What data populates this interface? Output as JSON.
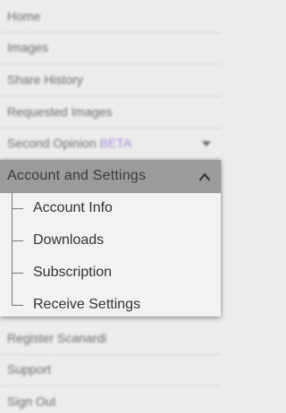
{
  "background_menu": {
    "items": [
      {
        "label": "Home"
      },
      {
        "label": "Images"
      },
      {
        "label": "Share History"
      },
      {
        "label": "Requested Images"
      },
      {
        "label": "Second Opinion",
        "badge": "BETA"
      },
      {
        "label": "Register Scanardi"
      },
      {
        "label": "Support"
      },
      {
        "label": "Sign Out"
      }
    ]
  },
  "menu": {
    "header_label": "Account and Settings",
    "items": [
      {
        "label": "Account Info"
      },
      {
        "label": "Downloads"
      },
      {
        "label": "Subscription"
      },
      {
        "label": "Receive Settings"
      }
    ]
  },
  "colors": {
    "header_bg": "#9b9b9b",
    "menu_bg": "#f2f2f2",
    "page_bg": "#ececec",
    "beta_accent": "#a58ad6"
  }
}
